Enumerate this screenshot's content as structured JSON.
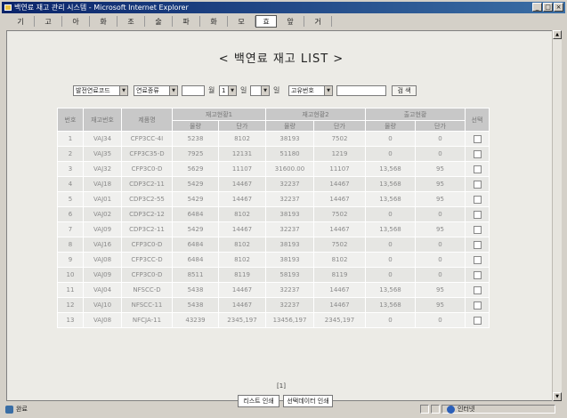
{
  "window": {
    "title": "백연료 재고 관리 시스템 - Microsoft Internet Explorer"
  },
  "toolbar": {
    "buttons": [
      "기",
      "고",
      "아",
      "화",
      "조",
      "술",
      "파",
      "화",
      "모",
      "효",
      "앞",
      "거"
    ]
  },
  "page": {
    "title": "< 백연료 재고 LIST >"
  },
  "filters": {
    "select1": "발전연료코드",
    "select2": "연료종류",
    "input1": "",
    "select3": "1",
    "sep1": "월",
    "sep2": "일",
    "select4": "",
    "sep3": "일",
    "select5": "고유번호",
    "input2": "",
    "search_label": "검 색"
  },
  "table": {
    "headers": {
      "no": "번호",
      "code": "재고번호",
      "name": "제품명",
      "group1": "재고현황1",
      "group2": "재고현황2",
      "group3": "출고현황",
      "select": "선택",
      "qty": "물량",
      "unit": "단가"
    },
    "rows": [
      [
        "1",
        "VAJ34",
        "CFP3CC-4I",
        "5238",
        "8102",
        "38193",
        "7502",
        "0",
        "0"
      ],
      [
        "2",
        "VAJ35",
        "CFP3C35-D",
        "7925",
        "12131",
        "51180",
        "1219",
        "0",
        "0"
      ],
      [
        "3",
        "VAJ32",
        "CFP3C0-D",
        "5629",
        "11107",
        "31600.00",
        "11107",
        "13,568",
        "95"
      ],
      [
        "4",
        "VAJ18",
        "CDP3C2-11",
        "5429",
        "14467",
        "32237",
        "14467",
        "13,568",
        "95"
      ],
      [
        "5",
        "VAJ01",
        "CDP3C2-55",
        "5429",
        "14467",
        "32237",
        "14467",
        "13,568",
        "95"
      ],
      [
        "6",
        "VAJ02",
        "CDP3C2-12",
        "6484",
        "8102",
        "38193",
        "7502",
        "0",
        "0"
      ],
      [
        "7",
        "VAJ09",
        "CDP3C2-11",
        "5429",
        "14467",
        "32237",
        "14467",
        "13,568",
        "95"
      ],
      [
        "8",
        "VAJ16",
        "CFP3C0-D",
        "6484",
        "8102",
        "38193",
        "7502",
        "0",
        "0"
      ],
      [
        "9",
        "VAJ08",
        "CFP3CC-D",
        "6484",
        "8102",
        "38193",
        "8102",
        "0",
        "0"
      ],
      [
        "10",
        "VAJ09",
        "CFP3C0-D",
        "8511",
        "8119",
        "58193",
        "8119",
        "0",
        "0"
      ],
      [
        "11",
        "VAJ04",
        "NFSCC-D",
        "5438",
        "14467",
        "32237",
        "14467",
        "13,568",
        "95"
      ],
      [
        "12",
        "VAJ10",
        "NFSCC-11",
        "5438",
        "14467",
        "32237",
        "14467",
        "13,568",
        "95"
      ],
      [
        "13",
        "VAJ08",
        "NFCJA-11",
        "43239",
        "2345,197",
        "13456,197",
        "2345,197",
        "0",
        "0"
      ]
    ]
  },
  "paging": {
    "label": "[1]"
  },
  "buttons": {
    "list_print": "리스트 인쇄",
    "selected_print": "선택데이터 인쇄"
  },
  "status": {
    "left": "완료",
    "zone": "인터넷"
  }
}
